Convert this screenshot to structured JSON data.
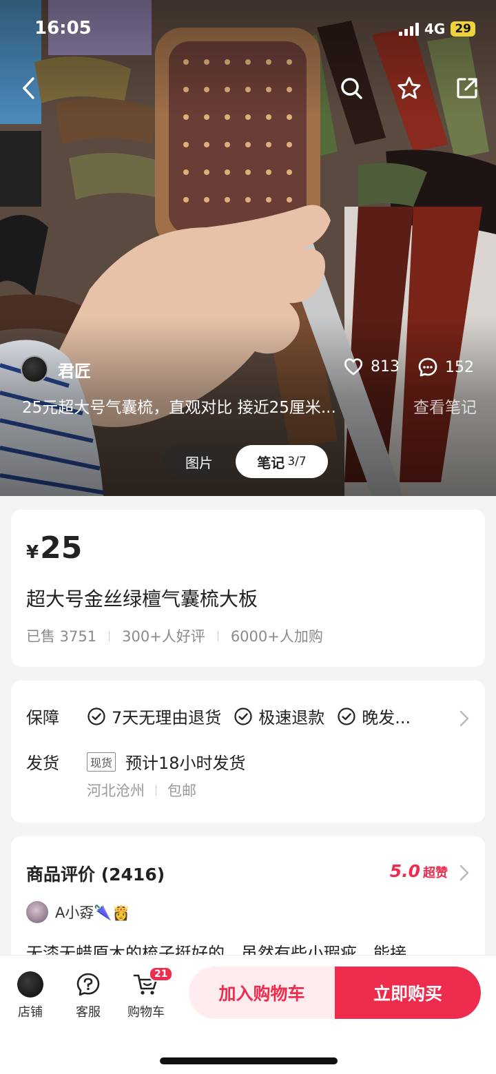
{
  "status": {
    "time": "16:05",
    "network": "4G",
    "battery": "29"
  },
  "post": {
    "author": "君匠",
    "likes": "813",
    "comments": "152",
    "text": "25元超大号气囊梳，直观对比 接近25厘米...",
    "link": "查看笔记"
  },
  "tabs": {
    "photos": "图片",
    "notes": "笔记",
    "notes_count": "3/7"
  },
  "product": {
    "currency": "¥",
    "price": "25",
    "title": "超大号金丝绿檀气囊梳大板",
    "sold": "已售 3751",
    "good_reviews": "300+人好评",
    "added": "6000+人加购"
  },
  "service": {
    "guarantee_label": "保障",
    "guarantees": [
      "7天无理由退货",
      "极速退款",
      "晚发..."
    ],
    "shipping_label": "发货",
    "stock_tag": "现货",
    "shipping_time": "预计18小时发货",
    "origin": "河北沧州",
    "postage": "包邮"
  },
  "reviews": {
    "title": "商品评价 (2416)",
    "score": "5.0",
    "score_tag": "超赞",
    "user": "A小孬🌂👸",
    "text": "无漆无蜡原木的梳子挺好的，虽然有些小瑕疵，能接"
  },
  "bottom": {
    "shop": "店铺",
    "service": "客服",
    "cart": "购物车",
    "cart_count": "21",
    "add_to_cart": "加入购物车",
    "buy_now": "立即购买"
  },
  "colors": {
    "accent": "#ee2d4e",
    "battery": "#f0d23a"
  }
}
